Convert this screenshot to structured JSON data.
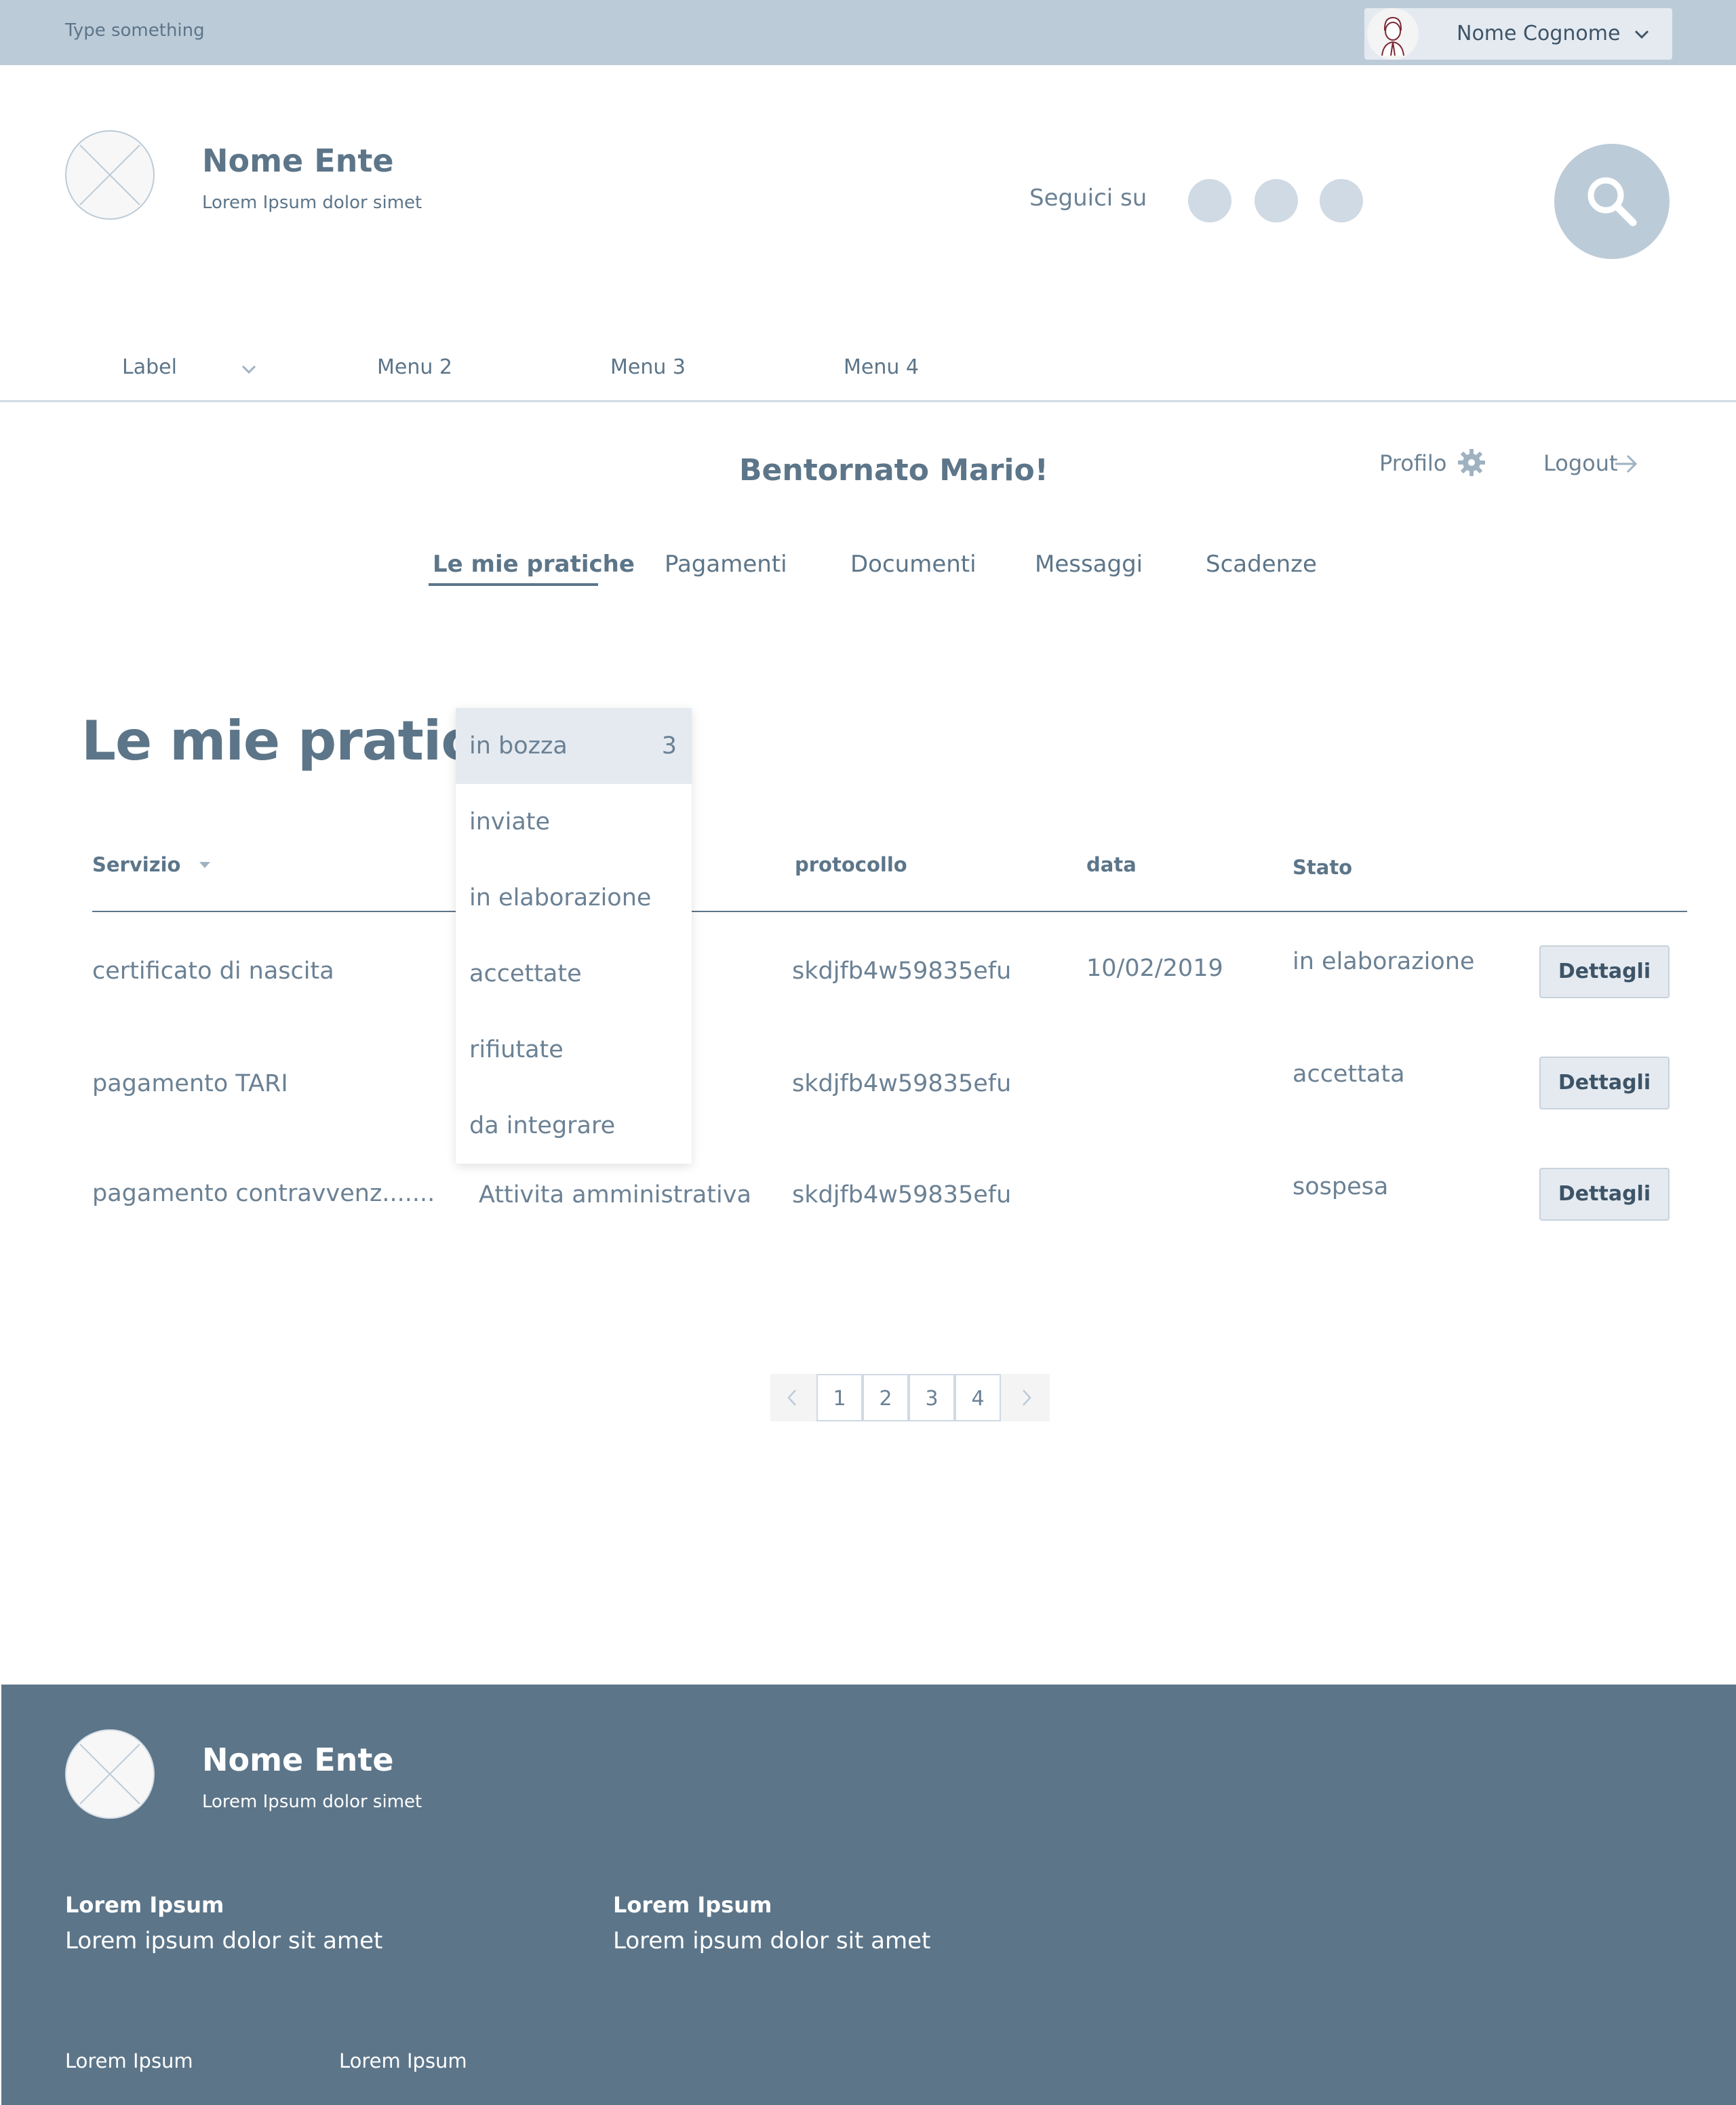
{
  "topbar": {
    "placeholder": "Type something",
    "user_name": "Nome Cognome"
  },
  "header": {
    "ente_name": "Nome Ente",
    "ente_subtitle": "Lorem Ipsum dolor simet",
    "follow_label": "Seguici su"
  },
  "menu": {
    "items": [
      "Label",
      "Menu 2",
      "Menu 3",
      "Menu 4"
    ]
  },
  "welcome": {
    "title": "Bentornato Mario!",
    "profile_label": "Profilo",
    "logout_label": "Logout"
  },
  "tabs": [
    "Le mie pratiche",
    "Pagamenti",
    "Documenti",
    "Messaggi",
    "Scadenze"
  ],
  "section": {
    "title": "Le mie pratiche"
  },
  "table": {
    "headers": {
      "servizio": "Servizio",
      "protocollo": "protocollo",
      "data": "data",
      "stato": "Stato"
    },
    "rows": [
      {
        "servizio": "certificato di nascita",
        "categoria": "",
        "protocollo": "skdjfb4w59835efu",
        "data": "10/02/2019",
        "stato": "in elaborazione",
        "action": "Dettagli"
      },
      {
        "servizio": "pagamento TARI",
        "categoria": "",
        "protocollo": "skdjfb4w59835efu",
        "data": "",
        "stato": "accettata",
        "action": "Dettagli"
      },
      {
        "servizio": "pagamento contravvenz.......",
        "categoria": "Attivita amministrativa",
        "protocollo": "skdjfb4w59835efu",
        "data": "",
        "stato": "sospesa",
        "action": "Dettagli"
      }
    ]
  },
  "status_dropdown": {
    "options": [
      {
        "label": "in bozza",
        "count": "3"
      },
      {
        "label": "inviate",
        "count": ""
      },
      {
        "label": "in elaborazione",
        "count": ""
      },
      {
        "label": "accettate",
        "count": ""
      },
      {
        "label": "rifiutate",
        "count": ""
      },
      {
        "label": "da integrare",
        "count": ""
      }
    ],
    "selected": "in bozza"
  },
  "pagination": {
    "pages": [
      "1",
      "2",
      "3",
      "4"
    ]
  },
  "footer": {
    "ente_name": "Nome Ente",
    "ente_subtitle": "Lorem Ipsum dolor simet",
    "columns": [
      {
        "title": "Lorem Ipsum",
        "text": "Lorem ipsum dolor sit amet"
      },
      {
        "title": "Lorem Ipsum",
        "text": "Lorem ipsum dolor sit amet"
      }
    ],
    "links": [
      "Lorem Ipsum",
      "Lorem Ipsum"
    ]
  },
  "colors": {
    "primary": "#5c7589",
    "topbar_bg": "#bccbd8",
    "light_accent": "#e4eaf0",
    "footer_bg": "#5c7589"
  },
  "icons": [
    "user-avatar-icon",
    "chevron-down-icon",
    "logo-placeholder-icon",
    "social-icon",
    "search-icon",
    "gear-icon",
    "arrow-right-icon",
    "sort-caret-icon",
    "chevron-left-icon",
    "chevron-right-icon"
  ]
}
